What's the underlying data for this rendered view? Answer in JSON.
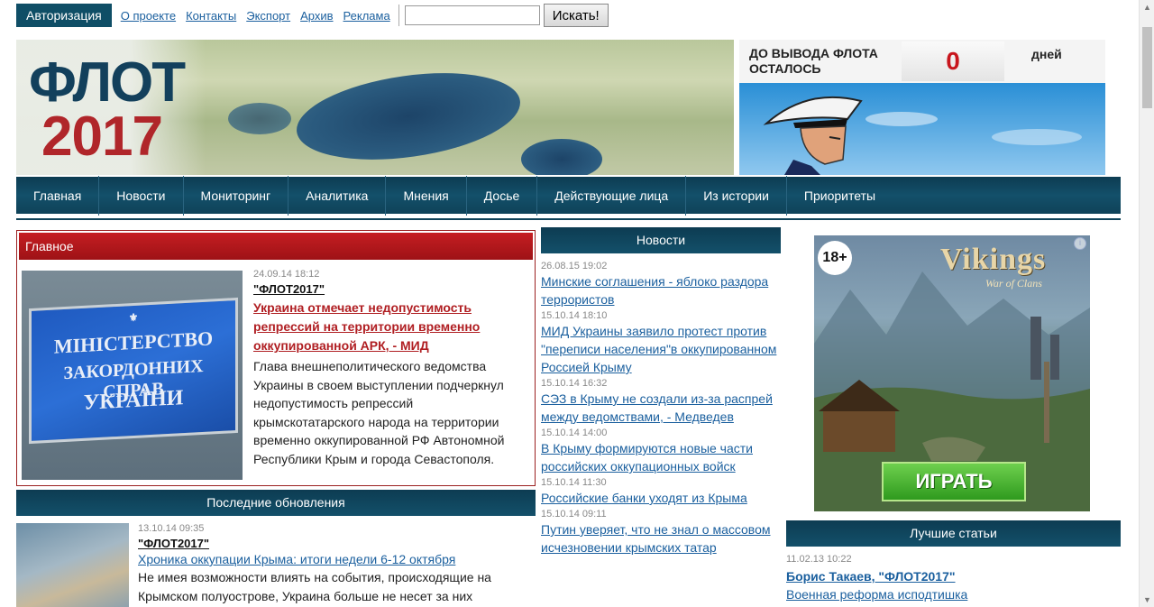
{
  "topbar": {
    "auth_label": "Авторизация",
    "links": [
      "О проекте",
      "Контакты",
      "Экспорт",
      "Архив",
      "Реклама"
    ],
    "search_placeholder": "",
    "search_button": "Искать!"
  },
  "header": {
    "logo_line1": "ФЛОТ",
    "logo_line2": "2017",
    "countdown_label": "ДО ВЫВОДА ФЛОТА ОСТАЛОСЬ",
    "countdown_value": "0",
    "countdown_unit": "дней"
  },
  "nav": [
    "Главная",
    "Новости",
    "Мониторинг",
    "Аналитика",
    "Мнения",
    "Досье",
    "Действующие лица",
    "Из истории",
    "Приоритеты"
  ],
  "main": {
    "heading": "Главное",
    "date": "24.09.14 18:12",
    "author": "\"ФЛОТ2017\"",
    "title": "Украина отмечает недопустимость репрессий на территории временно оккупированной АРК, - МИД",
    "lead": "Глава внешнеполитического ведомства Украины в своем выступлении подчеркнул недопустимость репрессий крымскотатарского народа на территории временно оккупированной РФ Автономной Республики Крым и города Севастополя.",
    "plaque_line1": "МІНІСТЕРСТВО",
    "plaque_line2": "ЗАКОРДОННИХ СПРАВ",
    "plaque_line3": "УКРАЇНИ"
  },
  "updates": {
    "heading": "Последние обновления",
    "date": "13.10.14 09:35",
    "author": "\"ФЛОТ2017\"",
    "title": "Хроника оккупации Крыма: итоги недели 6-12 октября",
    "lead": "Не имея возможности влиять на события, происходящие на Крымском полуострове, Украина больше не несет за них"
  },
  "news": {
    "heading": "Новости",
    "items": [
      {
        "date": "26.08.15 19:02",
        "title": "Минские соглашения - яблоко раздора террористов"
      },
      {
        "date": "15.10.14 18:10",
        "title": "МИД Украины заявило протест против \"переписи населения\"в оккупированном Россией Крыму"
      },
      {
        "date": "15.10.14 16:32",
        "title": "СЭЗ в Крыму не создали из-за распрей между ведомствами, - Медведев"
      },
      {
        "date": "15.10.14 14:00",
        "title": "В Крыму формируются новые части российских оккупационных войск"
      },
      {
        "date": "15.10.14 11:30",
        "title": "Российские банки уходят из Крыма"
      },
      {
        "date": "15.10.14 09:11",
        "title": "Путин уверяет, что не знал о массовом исчезновении крымских татар"
      }
    ]
  },
  "ad": {
    "age": "18+",
    "title": "Vikings",
    "subtitle": "War of Clans",
    "button": "ИГРАТЬ"
  },
  "best": {
    "heading": "Лучшие статьи",
    "date": "11.02.13 10:22",
    "author": "Борис Такаев, \"ФЛОТ2017\"",
    "title": "Военная реформа исподтишка"
  }
}
